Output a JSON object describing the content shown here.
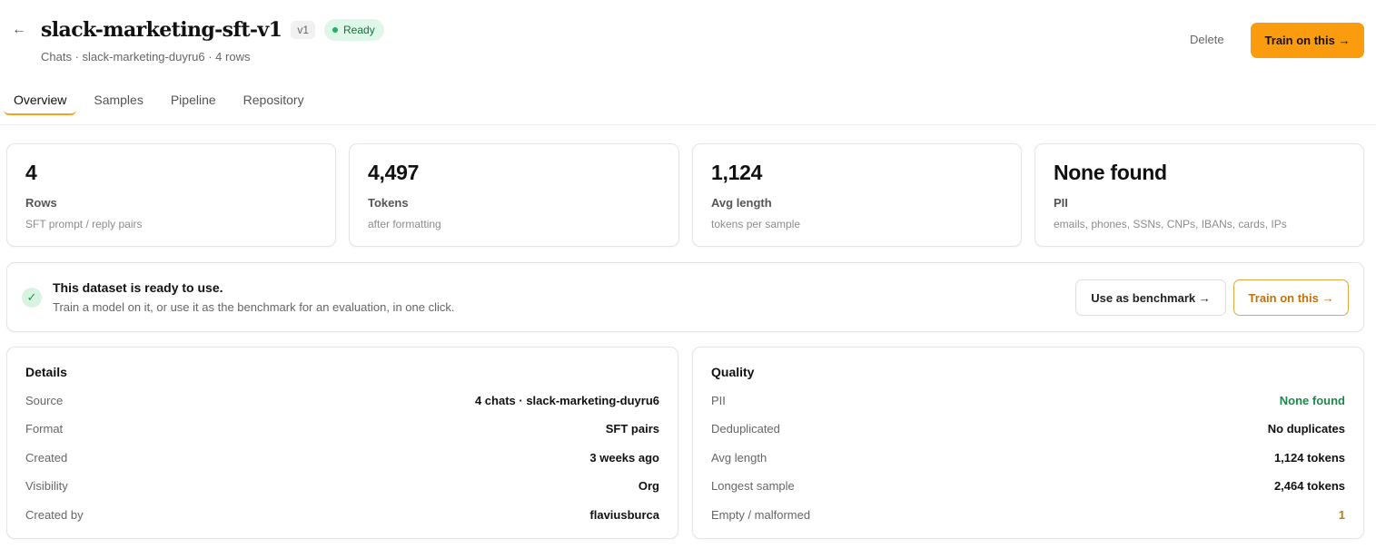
{
  "header": {
    "title": "slack-marketing-sft-v1",
    "version": "v1",
    "status": "Ready",
    "subtitle": "Chats · slack-marketing-duyru6 · 4 rows",
    "delete_label": "Delete",
    "train_label": "Train on this →",
    "back_icon": "←"
  },
  "tabs": [
    {
      "label": "Overview",
      "active": true
    },
    {
      "label": "Samples"
    },
    {
      "label": "Pipeline"
    },
    {
      "label": "Repository"
    }
  ],
  "stats": [
    {
      "value": "4",
      "label": "Rows",
      "desc": "SFT prompt / reply pairs"
    },
    {
      "value": "4,497",
      "label": "Tokens",
      "desc": "after formatting"
    },
    {
      "value": "1,124",
      "label": "Avg length",
      "desc": "tokens per sample"
    },
    {
      "value": "None found",
      "label": "PII",
      "desc": "emails, phones, SSNs, CNPs, IBANs, cards, IPs"
    }
  ],
  "banner": {
    "title": "This dataset is ready to use.",
    "subtitle": "Train a model on it, or use it as the benchmark for an evaluation, in one click.",
    "check_icon": "✓",
    "benchmark_label": "Use as benchmark →",
    "train_label": "Train on this →"
  },
  "details": {
    "title": "Details",
    "rows": [
      {
        "key": "Source",
        "value": "4 chats · slack-marketing-duyru6"
      },
      {
        "key": "Format",
        "value": "SFT pairs"
      },
      {
        "key": "Created",
        "value": "3 weeks ago"
      },
      {
        "key": "Visibility",
        "value": "Org"
      },
      {
        "key": "Created by",
        "value": "flaviusburca"
      }
    ]
  },
  "quality": {
    "title": "Quality",
    "rows": [
      {
        "key": "PII",
        "value": "None found"
      },
      {
        "key": "Deduplicated",
        "value": "No duplicates"
      },
      {
        "key": "Avg length",
        "value": "1,124 tokens"
      },
      {
        "key": "Longest sample",
        "value": "2,464 tokens"
      },
      {
        "key": "Empty / malformed",
        "value": "1"
      }
    ]
  },
  "colors": {
    "accent": "#fb9c0f",
    "ready_green": "#1db363",
    "pii_green": "#1a8a4a",
    "warn_orange": "#c27710"
  }
}
